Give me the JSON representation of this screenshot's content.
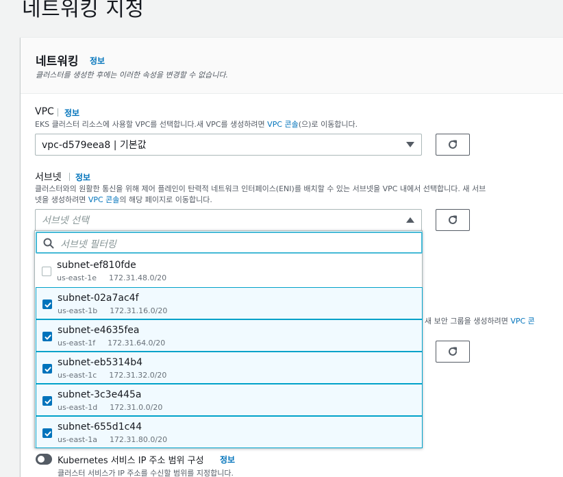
{
  "page": {
    "title": "네트워킹 지정"
  },
  "section": {
    "title": "네트워킹",
    "info": "정보",
    "description": "클러스터를 생성한 후에는 이러한 속성을 변경할 수 없습니다."
  },
  "vpc": {
    "label": "VPC",
    "info": "정보",
    "desc_pre": "EKS 클러스터 리소스에 사용할 VPC를 선택합니다.새 VPC를 생성하려면 ",
    "desc_link": "VPC 콘솔",
    "desc_post": "(으)로 이동합니다.",
    "selected": "vpc-d579eea8 | 기본값"
  },
  "subnet": {
    "label": "서브넷",
    "info": "정보",
    "desc_line1": "클러스터와의 원활한 통신을 위해 제어 플레인이 탄력적 네트워크 인터페이스(ENI)를 배치할 수 있는 서브넷을 VPC 내에서 선택합니다. 새 서브",
    "desc_pre2": "넷을 생성하려면 ",
    "desc_link": "VPC 콘솔",
    "desc_post2": "의 해당 페이지로 이동합니다.",
    "placeholder": "서브넷 선택",
    "filter_placeholder": "서브넷 필터링",
    "options": [
      {
        "name": "subnet-ef810fde",
        "az": "us-east-1e",
        "cidr": "172.31.48.0/20",
        "checked": false
      },
      {
        "name": "subnet-02a7ac4f",
        "az": "us-east-1b",
        "cidr": "172.31.16.0/20",
        "checked": true
      },
      {
        "name": "subnet-e4635fea",
        "az": "us-east-1f",
        "cidr": "172.31.64.0/20",
        "checked": true
      },
      {
        "name": "subnet-eb5314b4",
        "az": "us-east-1c",
        "cidr": "172.31.32.0/20",
        "checked": true
      },
      {
        "name": "subnet-3c3e445a",
        "az": "us-east-1d",
        "cidr": "172.31.0.0/20",
        "checked": true
      },
      {
        "name": "subnet-655d1c44",
        "az": "us-east-1a",
        "cidr": "172.31.80.0/20",
        "checked": true
      }
    ]
  },
  "security_group": {
    "desc_pre": "새 보안 그룹을 생성하려면 ",
    "desc_link": "VPC 콘"
  },
  "k8s": {
    "label": "Kubernetes 서비스 IP 주소 범위 구성",
    "info": "정보",
    "description": "클러스터 서비스가 IP 주소를 수신할 범위를 지정합니다.",
    "enabled": false
  },
  "colors": {
    "accent": "#0073bb",
    "focus": "#44b9d6",
    "selected_bg": "#f1faff"
  },
  "icons": {
    "refresh": "refresh-icon",
    "search": "search-icon",
    "caret": "caret-icon",
    "checkbox": "check-icon"
  }
}
